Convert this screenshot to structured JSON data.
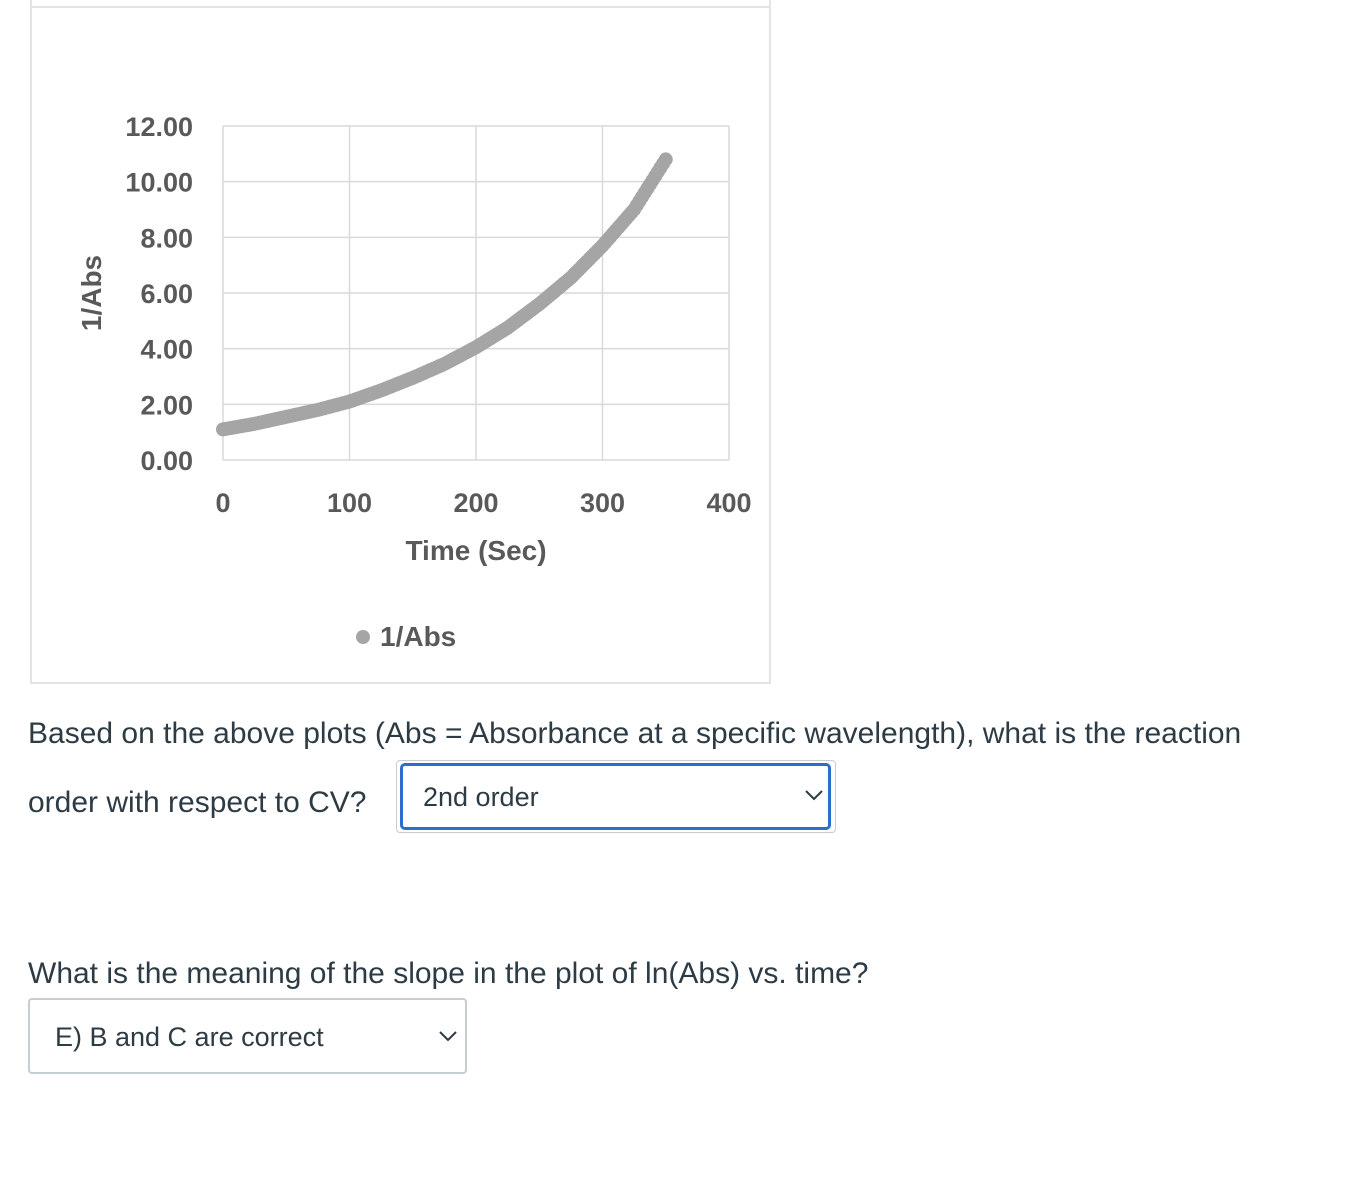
{
  "chart_data": {
    "type": "scatter",
    "title": "",
    "xlabel": "Time (Sec)",
    "ylabel": "1/Abs",
    "xlim": [
      0,
      400
    ],
    "ylim": [
      0,
      12
    ],
    "x_ticks": [
      "0",
      "100",
      "200",
      "300",
      "400"
    ],
    "y_ticks": [
      "0.00",
      "2.00",
      "4.00",
      "6.00",
      "8.00",
      "10.00",
      "12.00"
    ],
    "grid": true,
    "legend": "bottom",
    "series": [
      {
        "name": "1/Abs",
        "color": "#a5a5a5",
        "x": [
          0,
          25,
          50,
          75,
          100,
          125,
          150,
          175,
          200,
          225,
          250,
          275,
          300,
          325,
          350
        ],
        "y": [
          1.1,
          1.3,
          1.55,
          1.8,
          2.1,
          2.5,
          2.95,
          3.45,
          4.05,
          4.75,
          5.6,
          6.55,
          7.7,
          9.0,
          10.8
        ]
      }
    ]
  },
  "questions": [
    {
      "text_line1": "Based on the above plots (Abs = Absorbance at a specific wavelength), what is the reaction",
      "text_line2": "order with respect to CV?",
      "selected": "2nd order",
      "chevron_icon": "chevron-down-icon"
    },
    {
      "text": "What is the meaning of the slope in the plot of ln(Abs) vs. time?",
      "selected": "E) B and C are correct",
      "chevron_icon": "chevron-down-icon"
    }
  ]
}
